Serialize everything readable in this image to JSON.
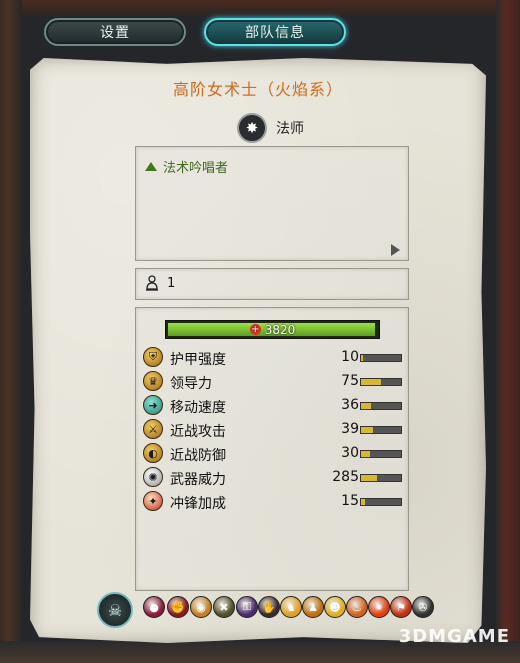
{
  "tabs": {
    "settings": "设置",
    "unit_info": "部队信息"
  },
  "unit": {
    "title": "高阶女术士（火焰系）",
    "class_label": "法师",
    "trait": "法术吟唱者",
    "rank": "1",
    "health": {
      "value": "3820",
      "fill_fraction": 0.99
    }
  },
  "stats": [
    {
      "label": "护甲强度",
      "value": "10",
      "fill": 0.05,
      "icon": "armor-icon"
    },
    {
      "label": "领导力",
      "value": "75",
      "fill": 0.5,
      "icon": "leadership-icon"
    },
    {
      "label": "移动速度",
      "value": "36",
      "fill": 0.25,
      "icon": "speed-icon"
    },
    {
      "label": "近战攻击",
      "value": "39",
      "fill": 0.3,
      "icon": "melee-attack-icon"
    },
    {
      "label": "近战防御",
      "value": "30",
      "fill": 0.22,
      "icon": "melee-defense-icon"
    },
    {
      "label": "武器威力",
      "value": "285",
      "fill": 0.4,
      "icon": "weapon-strength-icon"
    },
    {
      "label": "冲锋加成",
      "value": "15",
      "fill": 0.1,
      "icon": "charge-bonus-icon"
    }
  ],
  "abilities": [
    {
      "icon": "ability-1-icon",
      "color": "#8a1a3a"
    },
    {
      "icon": "ability-2-icon",
      "color": "#8a1a1a"
    },
    {
      "icon": "ability-3-icon",
      "color": "#c08020"
    },
    {
      "icon": "ability-4-icon",
      "color": "#50502a"
    },
    {
      "icon": "ability-5-icon",
      "color": "#4a2a6a"
    },
    {
      "icon": "ability-6-icon",
      "color": "#3a2a2a"
    },
    {
      "icon": "ability-7-icon",
      "color": "#e0a020"
    },
    {
      "icon": "ability-8-icon",
      "color": "#c07010"
    },
    {
      "icon": "ability-9-icon",
      "color": "#e0b020"
    },
    {
      "icon": "ability-10-icon",
      "color": "#d06020"
    },
    {
      "icon": "ability-11-icon",
      "color": "#e04010"
    },
    {
      "icon": "ability-12-icon",
      "color": "#c03010"
    },
    {
      "icon": "ability-13-icon",
      "color": "#303030"
    }
  ],
  "watermark": {
    "prefix": "3DM",
    "suffix": "GAME"
  }
}
